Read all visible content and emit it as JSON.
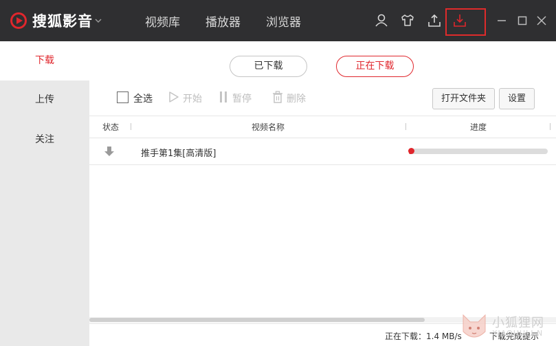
{
  "app": {
    "name": "搜狐影音"
  },
  "nav": {
    "library": "视频库",
    "player": "播放器",
    "browser": "浏览器"
  },
  "icons": {
    "logo": "play-circle-icon",
    "user": "user-icon",
    "skin": "tshirt-icon",
    "upload": "upload-icon",
    "download": "download-icon",
    "minimize": "minimize-icon",
    "maximize": "maximize-icon",
    "close": "close-icon"
  },
  "sidebar": {
    "items": [
      {
        "label": "下载"
      },
      {
        "label": "上传"
      },
      {
        "label": "关注"
      }
    ]
  },
  "tabs": {
    "downloaded": "已下载",
    "downloading": "正在下载"
  },
  "toolbar": {
    "select_all": "全选",
    "start": "开始",
    "pause": "暂停",
    "delete": "删除",
    "open_folder": "打开文件夹",
    "settings": "设置"
  },
  "table": {
    "columns": {
      "status": "状态",
      "name": "视频名称",
      "progress": "进度"
    }
  },
  "list": {
    "rows": [
      {
        "name": "推手第1集[高清版]",
        "progress": 0.02
      }
    ]
  },
  "status": {
    "speed": "正在下载：1.4 MB/s",
    "hint": "下载完成提示"
  },
  "watermark": {
    "text": "小狐狸网",
    "url": "XIAOHULI.N"
  },
  "colors": {
    "accent": "#e0262c",
    "titlebar": "#2f2f31",
    "sidebar": "#e9e9e9",
    "highlight_box": "#e02b2b"
  }
}
